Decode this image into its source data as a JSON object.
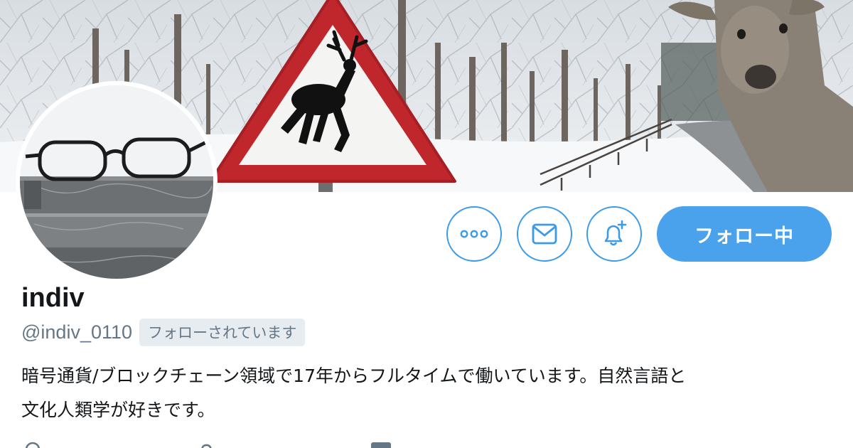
{
  "profile": {
    "display_name": "indiv",
    "handle": "@indiv_0110",
    "follows_you_badge": "フォローされています",
    "bio_lines": [
      "暗号通貨/ブロックチェーン領域で17年からフルタイムで働いています。自然言語と",
      "文化人類学が好きです。"
    ]
  },
  "actions": {
    "more_icon": "more-dots-icon",
    "dm_icon": "envelope-icon",
    "notify_icon": "bell-plus-icon",
    "follow_label": "フォロー中"
  },
  "colors": {
    "accent": "#4aa1ec",
    "accent_border": "#3c9be9",
    "muted_text": "#657786",
    "badge_bg": "#e6ecf0",
    "sign_red": "#c0272d"
  },
  "banner": {
    "description_icon": "deer-crossing-sign-icon"
  },
  "meta_icons": [
    "location-icon",
    "link-icon",
    "calendar-icon"
  ]
}
